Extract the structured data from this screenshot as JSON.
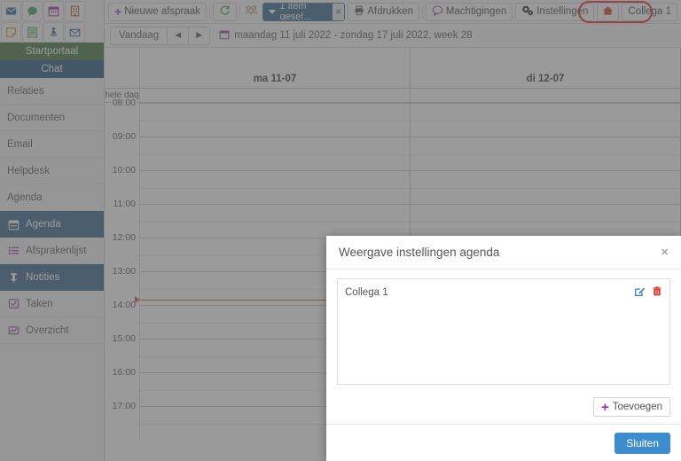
{
  "icon_strip": {
    "row1": [
      {
        "name": "mail-icon",
        "color": "#2b5f99"
      },
      {
        "name": "chat-bubble-icon",
        "color": "#3e9c4e"
      },
      {
        "name": "calendar-icon",
        "color": "#8d3b8d"
      },
      {
        "name": "building-icon",
        "color": "#a4583c"
      },
      {
        "name": "note-icon",
        "color": "#c8a11c"
      }
    ],
    "row2": [
      {
        "name": "list-document-icon",
        "color": "#3e9c4e"
      },
      {
        "name": "person-pin-icon",
        "color": "#2b5f99"
      },
      {
        "name": "envelope-open-icon",
        "color": "#2b5f99"
      },
      {
        "name": "euro-yellow-icon",
        "color": "#d8b531"
      },
      {
        "name": "euro-dark-icon",
        "color": "#3a3a3a"
      }
    ]
  },
  "toolbar": {
    "new_appointment": "Nieuwe afspraak",
    "refresh_icon": "refresh-icon",
    "group_icon": "group-users-icon",
    "selection_label": "1 item gesel...",
    "selection_clear": "×",
    "print": "Afdrukken",
    "permissions": "Machtigingen",
    "settings": "Instellingen",
    "home_icon": "home-icon",
    "user_tab": "Collega 1",
    "highlight_color": "#e8202a"
  },
  "datebar": {
    "today": "Vandaag",
    "prev": "◄",
    "next": "►",
    "range": "maandag 11 juli 2022 - zondag 17 juli 2022, week 28"
  },
  "sidebar": {
    "top": [
      {
        "label": "Startportaal",
        "style": "green"
      },
      {
        "label": "Chat",
        "style": "blue"
      }
    ],
    "items": [
      {
        "label": "Relaties",
        "icon": null,
        "selected": false
      },
      {
        "label": "Documenten",
        "icon": null,
        "selected": false
      },
      {
        "label": "Email",
        "icon": null,
        "selected": false
      },
      {
        "label": "Helpdesk",
        "icon": null,
        "selected": false
      },
      {
        "label": "Agenda",
        "icon": null,
        "selected": false
      },
      {
        "label": "Agenda",
        "icon": "calendar-icon",
        "selected": true
      },
      {
        "label": "Afsprakenlijst",
        "icon": "list-icon",
        "selected": false
      },
      {
        "label": "Notities",
        "icon": "pin-icon",
        "selected": true
      },
      {
        "label": "Taken",
        "icon": "checkbox-icon",
        "selected": false
      },
      {
        "label": "Overzicht",
        "icon": "chart-icon",
        "selected": false
      }
    ]
  },
  "calendar": {
    "allday_label": "hele dag",
    "days": [
      "ma 11-07",
      "di 12-07"
    ],
    "hours": [
      "08:00",
      "09:00",
      "10:00",
      "11:00",
      "12:00",
      "13:00",
      "14:00",
      "15:00",
      "16:00",
      "17:00"
    ],
    "now_indicator_color": "#d9534f"
  },
  "modal": {
    "title": "Weergave instellingen agenda",
    "close_x": "×",
    "rows": [
      {
        "label": "Collega 1",
        "edit_icon": "edit-pencil-icon",
        "delete_icon": "trash-icon"
      }
    ],
    "add_label": "Toevoegen",
    "add_plus": "+",
    "close_label": "Sluiten",
    "primary_color": "#3c8dcd"
  }
}
